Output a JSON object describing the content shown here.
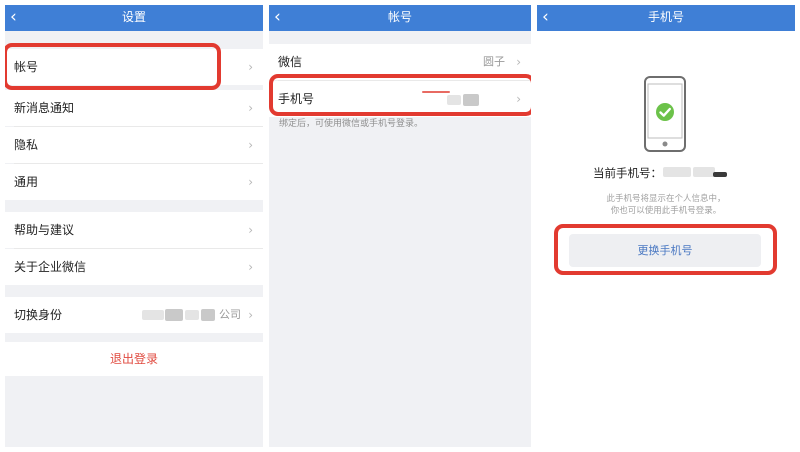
{
  "back_glyph": "‹",
  "chevron_glyph": "›",
  "settings": {
    "title": "设置",
    "items": [
      {
        "label": "帐号"
      },
      {
        "label": "新消息通知"
      },
      {
        "label": "隐私"
      },
      {
        "label": "通用"
      },
      {
        "label": "帮助与建议"
      },
      {
        "label": "关于企业微信"
      },
      {
        "label": "切换身份",
        "value_suffix": "公司"
      }
    ],
    "logout": "退出登录"
  },
  "account": {
    "title": "帐号",
    "items": [
      {
        "label": "微信",
        "value": "圆子"
      },
      {
        "label": "手机号"
      }
    ],
    "hint": "绑定后，可使用微信或手机号登录。"
  },
  "phone": {
    "title": "手机号",
    "current_label": "当前手机号：",
    "desc_line1": "此手机号将显示在个人信息中，",
    "desc_line2": "你也可以使用此手机号登录。",
    "change_button": "更换手机号"
  },
  "colors": {
    "header": "#3f7fd6",
    "highlight": "#e23a30",
    "logout": "#e04a3f",
    "check": "#6cc24a",
    "link": "#4a78c2"
  }
}
